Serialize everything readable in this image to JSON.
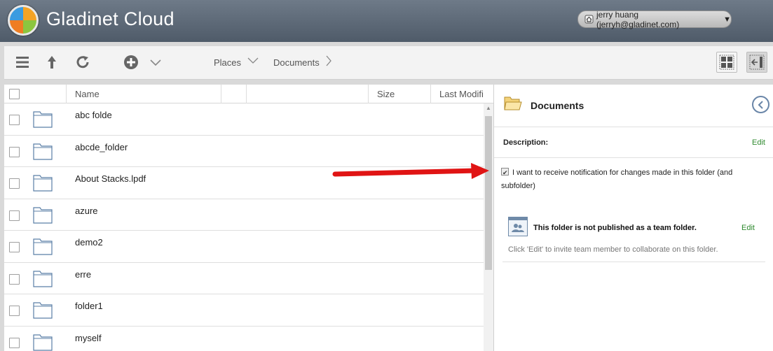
{
  "header": {
    "app_title": "Gladinet Cloud",
    "user_label": "jerry huang  (jerryh@gladinet.com)",
    "user_caret": "▼"
  },
  "toolbar": {
    "icons": [
      "menu-icon",
      "up-arrow-icon",
      "refresh-icon",
      "add-circle-icon",
      "chevron-down-icon"
    ],
    "crumbs": [
      {
        "label": "Places",
        "sep": "∨"
      },
      {
        "label": "Documents",
        "sep": ">"
      }
    ],
    "view_buttons": [
      "grid-view-icon",
      "panel-toggle-icon"
    ]
  },
  "list": {
    "columns": [
      "Name",
      "",
      "",
      "Size",
      "Last Modifi"
    ],
    "rows": [
      {
        "name": "abc folde"
      },
      {
        "name": "abcde_folder"
      },
      {
        "name": "About Stacks.lpdf"
      },
      {
        "name": "azure"
      },
      {
        "name": "demo2"
      },
      {
        "name": "erre"
      },
      {
        "name": "folder1"
      },
      {
        "name": "myself"
      }
    ]
  },
  "panel": {
    "title": "Documents",
    "description_label": "Description:",
    "edit_label": "Edit",
    "notify_text": "I want to receive notification for changes made in this folder (and subfolder)",
    "notify_checked": true,
    "team_title": "This folder is not published as a team folder.",
    "team_edit": "Edit",
    "team_hint": "Click 'Edit' to invite team member to collaborate on this folder."
  },
  "colors": {
    "header_bg": "#5f6b79",
    "link_green": "#2f8a2f",
    "annotation_arrow": "#e01414"
  }
}
